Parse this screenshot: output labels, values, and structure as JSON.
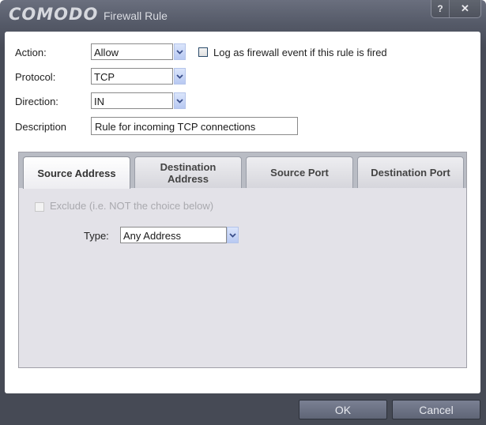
{
  "window": {
    "logo": "COMODO",
    "title": "Firewall Rule",
    "help_label": "?",
    "close_label": "✕"
  },
  "form": {
    "action": {
      "label": "Action:",
      "value": "Allow"
    },
    "log_event": {
      "label": "Log as firewall event if this rule is fired",
      "checked": false
    },
    "protocol": {
      "label": "Protocol:",
      "value": "TCP"
    },
    "direction": {
      "label": "Direction:",
      "value": "IN"
    },
    "description": {
      "label": "Description",
      "value": "Rule for incoming TCP connections"
    }
  },
  "tabs": [
    {
      "label": "Source Address",
      "active": true
    },
    {
      "label": "Destination Address",
      "active": false
    },
    {
      "label": "Source Port",
      "active": false
    },
    {
      "label": "Destination Port",
      "active": false
    }
  ],
  "tab_content": {
    "exclude": {
      "label": "Exclude (i.e. NOT the choice below)",
      "checked": false,
      "disabled": true
    },
    "type": {
      "label": "Type:",
      "value": "Any Address"
    }
  },
  "footer": {
    "ok_label": "OK",
    "cancel_label": "Cancel"
  }
}
